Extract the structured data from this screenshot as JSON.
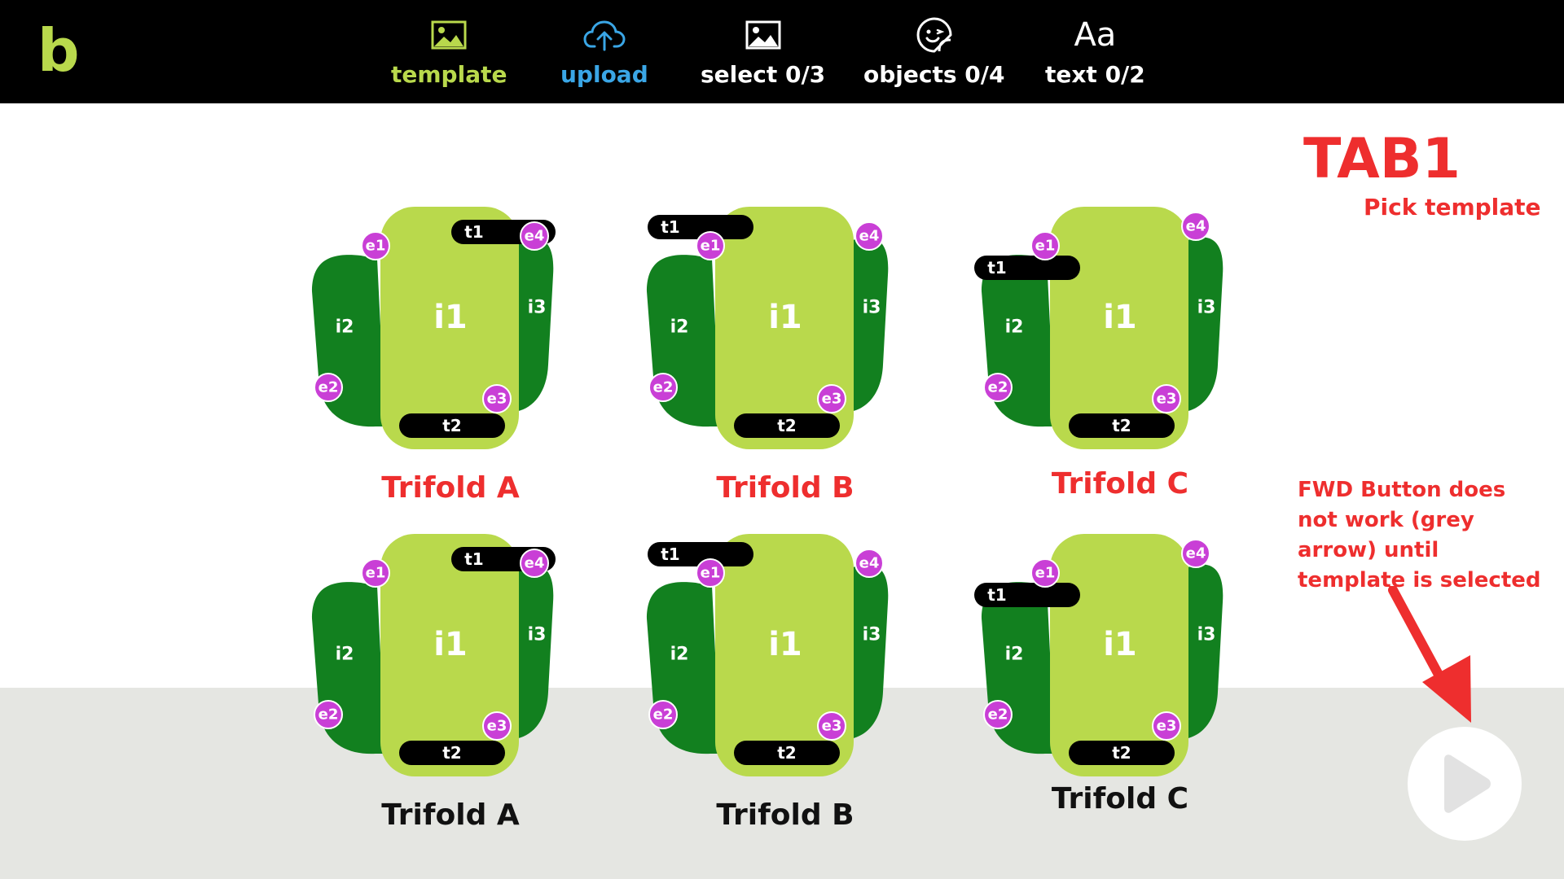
{
  "logo": "b",
  "nav": {
    "tabs": [
      {
        "label": "template",
        "icon": "image-icon",
        "color": "#b9d94c"
      },
      {
        "label": "upload",
        "icon": "cloud-upload-icon",
        "color": "#3aa6e6"
      },
      {
        "label": "select 0/3",
        "icon": "image-icon",
        "color": "#ffffff"
      },
      {
        "label": "objects 0/4",
        "icon": "sticker-icon",
        "color": "#ffffff"
      },
      {
        "label": "text 0/2",
        "icon": "text-icon",
        "color": "#ffffff",
        "glyph": "Aa"
      }
    ]
  },
  "annotation": {
    "tab_title": "TAB1",
    "tab_subtitle": "Pick template",
    "fwd_note": "FWD Button does not work (grey arrow) until template is selected",
    "color": "#ee2e2e"
  },
  "labels": {
    "t1": "t1",
    "t2": "t2",
    "i1": "i1",
    "i2": "i2",
    "i3": "i3",
    "e1": "e1",
    "e2": "e2",
    "e3": "e3",
    "e4": "e4"
  },
  "templates": [
    {
      "title": "Trifold A",
      "variant": "A",
      "title_color": "#ee2e2e"
    },
    {
      "title": "Trifold B",
      "variant": "B",
      "title_color": "#ee2e2e"
    },
    {
      "title": "Trifold C",
      "variant": "C",
      "title_color": "#ee2e2e"
    },
    {
      "title": "Trifold A",
      "variant": "A",
      "title_color": "#111111"
    },
    {
      "title": "Trifold B",
      "variant": "B",
      "title_color": "#111111"
    },
    {
      "title": "Trifold C",
      "variant": "C",
      "title_color": "#111111"
    }
  ],
  "colors": {
    "light_green": "#b9d94c",
    "dark_green": "#12801f",
    "magenta": "#c93fd6",
    "grey_band": "#e5e6e2",
    "fwd_arrow": "#e2e2e2"
  },
  "fwd_button": {
    "icon": "play-arrow-icon",
    "enabled": false
  }
}
